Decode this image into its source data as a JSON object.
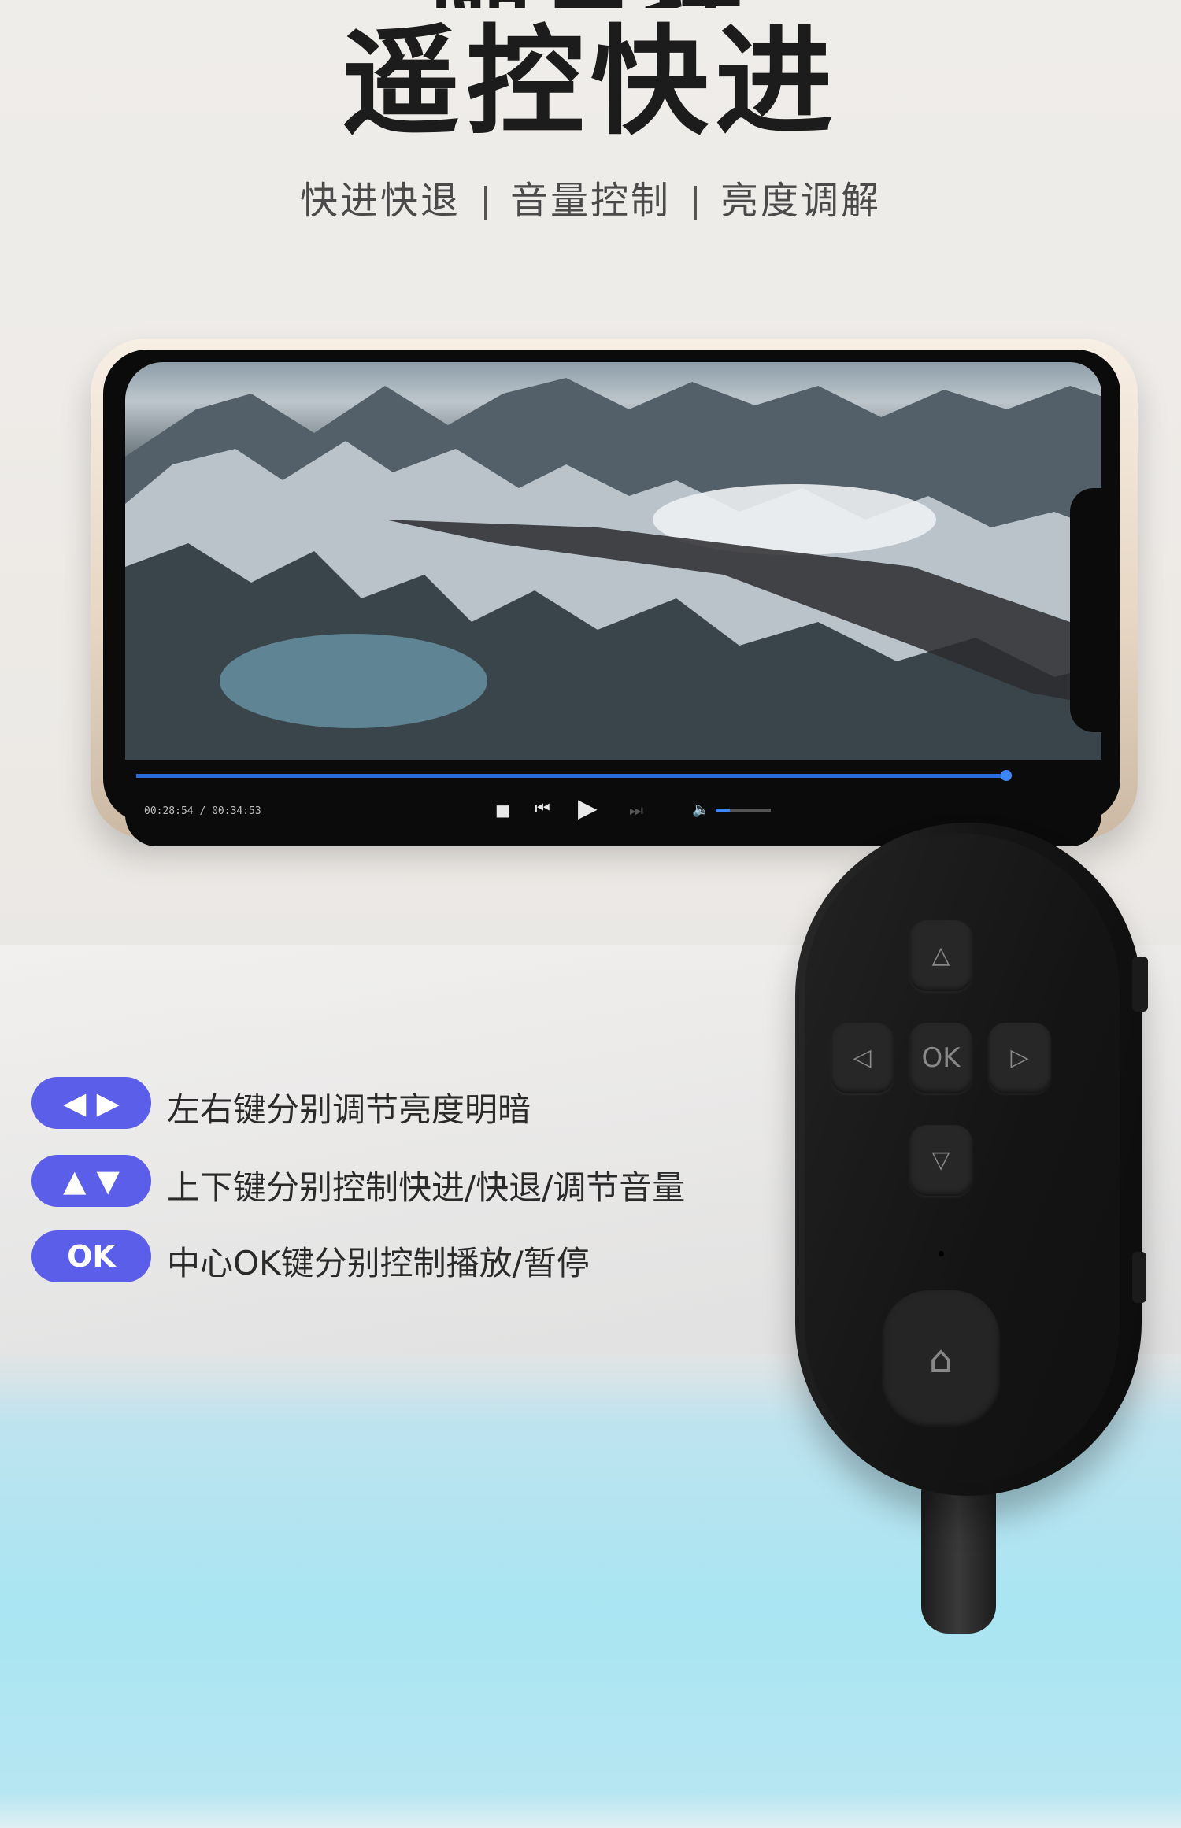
{
  "headline": {
    "top_cut": "随意摆",
    "title": "遥控快进"
  },
  "subheadline": {
    "items": [
      "快进快退",
      "音量控制",
      "亮度调解"
    ]
  },
  "player": {
    "time": "00:28:54 / 00:34:53",
    "icons": [
      "stop-icon",
      "previous-icon",
      "play-icon",
      "next-icon",
      "volume-icon"
    ],
    "progress": 0.88,
    "volume": 0.25
  },
  "features": [
    {
      "badge": "◀ ▶",
      "text": "左右键分别调节亮度明暗",
      "badge_icon": "left-right-arrows-icon"
    },
    {
      "badge": "▲ ▼",
      "text": "上下键分别控制快进/快退/调节音量",
      "badge_icon": "up-down-arrows-icon"
    },
    {
      "badge": "OK",
      "text": "中心OK键分别控制播放/暂停",
      "badge_icon": "ok-badge"
    }
  ],
  "remote": {
    "ok_label": "OK",
    "accent": "#5a5ee8"
  }
}
